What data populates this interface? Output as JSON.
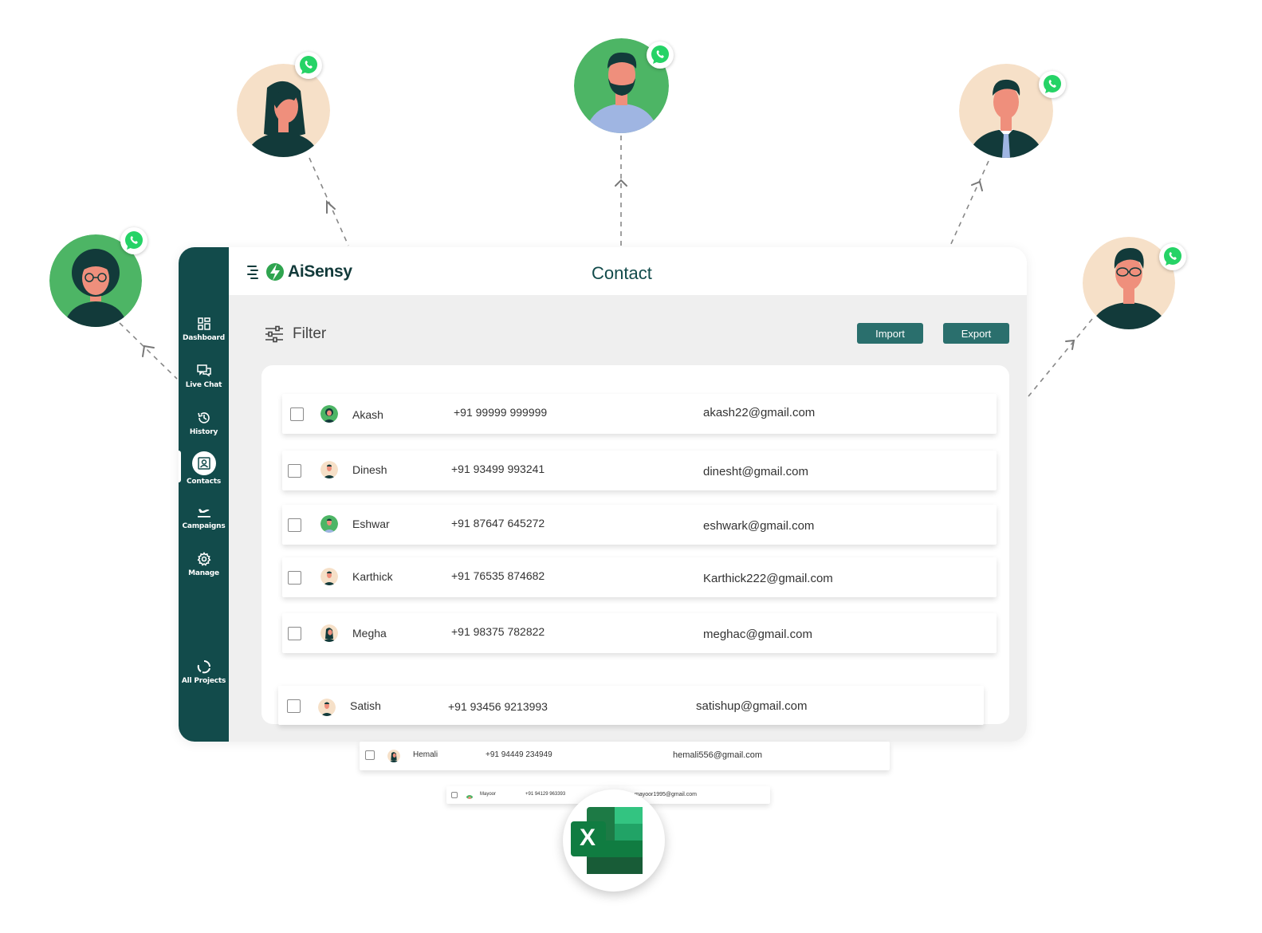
{
  "app": {
    "brand": "AiSensy",
    "page_title": "Contact",
    "colors": {
      "sidebar": "#124b4b",
      "button": "#2a6f6d",
      "accent_green": "#25d366",
      "content_bg": "#efefef"
    }
  },
  "sidebar": {
    "items": [
      {
        "label": "Dashboard",
        "icon": "dashboard-icon"
      },
      {
        "label": "Live Chat",
        "icon": "chat-icon"
      },
      {
        "label": "History",
        "icon": "history-icon"
      },
      {
        "label": "Contacts",
        "icon": "contacts-icon",
        "active": true
      },
      {
        "label": "Campaigns",
        "icon": "campaign-plane-icon"
      },
      {
        "label": "Manage",
        "icon": "gear-icon"
      }
    ],
    "footer": {
      "label": "All Projects",
      "icon": "refresh-icon"
    }
  },
  "toolbar": {
    "filter_label": "Filter",
    "import_label": "Import",
    "export_label": "Export"
  },
  "contacts": [
    {
      "name": "Akash",
      "phone": "+91 99999 999999",
      "email": "akash22@gmail.com"
    },
    {
      "name": "Dinesh",
      "phone": "+91 93499 993241",
      "email": "dinesht@gmail.com"
    },
    {
      "name": "Eshwar",
      "phone": "+91 87647 645272",
      "email": "eshwark@gmail.com"
    },
    {
      "name": "Karthick",
      "phone": "+91 76535 874682",
      "email": "Karthick222@gmail.com"
    },
    {
      "name": "Megha",
      "phone": "+91 98375 782822",
      "email": "meghac@gmail.com"
    },
    {
      "name": "Satish",
      "phone": "+91 93456 9213993",
      "email": "satishup@gmail.com"
    },
    {
      "name": "Hemali",
      "phone": "+91 94449 234949",
      "email": "hemali556@gmail.com"
    },
    {
      "name": "Mayoor",
      "phone": "+91 94129 963393",
      "email": "mayoor1995@gmail.com"
    }
  ],
  "decorations": {
    "avatar_badge_icon": "whatsapp-icon",
    "export_target_icon": "excel-icon",
    "excel_letter": "X"
  }
}
